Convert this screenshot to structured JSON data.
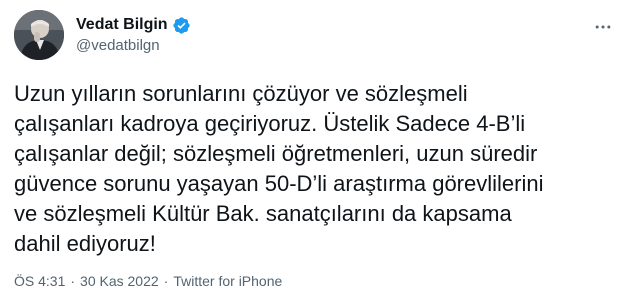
{
  "author": {
    "display_name": "Vedat Bilgin",
    "handle": "@vedatbilgn",
    "verified_color": "#1d9bf0"
  },
  "tweet": {
    "lines": [
      "Uzun yılların sorunlarını çözüyor ve sözleşmeli",
      "çalışanları kadroya geçiriyoruz. Üstelik Sadece 4-B’li",
      "çalışanlar değil; sözleşmeli öğretmenleri, uzun süredir",
      "güvence sorunu yaşayan 50-D’li araştırma görevlilerini",
      "ve sözleşmeli Kültür Bak. sanatçılarını da kapsama",
      "dahil ediyoruz!"
    ]
  },
  "meta": {
    "time": "ÖS 4:31",
    "separator": "·",
    "date": "30 Kas 2022",
    "source": "Twitter for iPhone"
  },
  "icons": {
    "more": "more-horizontal-icon",
    "verified": "verified-badge-icon"
  }
}
